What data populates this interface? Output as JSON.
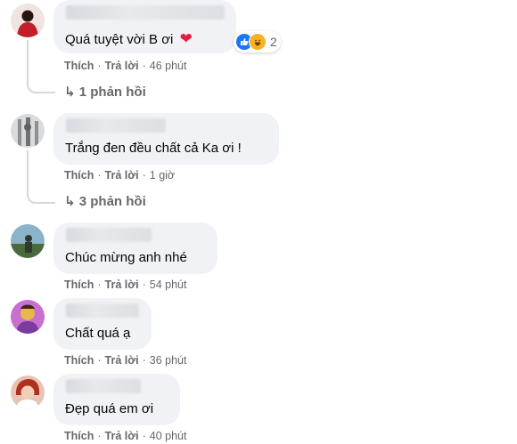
{
  "comments": [
    {
      "text": "Quá tuyệt vời B ơi",
      "emoji": "❤",
      "reaction_count": "2",
      "like": "Thích",
      "reply": "Trả lời",
      "time": "46 phút",
      "replies": "↳ 1 phản hồi",
      "colors": {
        "avatar_bg": "#c41e2a",
        "avatar_fg": "#2a1512"
      }
    },
    {
      "text": "Trắng đen đều chất cả Ka ơi !",
      "like": "Thích",
      "reply": "Trả lời",
      "time": "1 giờ",
      "replies": "↳ 3 phản hồi",
      "colors": {
        "avatar_bg": "#d9dbdc",
        "avatar_fg": "#5f6163"
      }
    },
    {
      "text": "Chúc mừng anh nhé",
      "like": "Thích",
      "reply": "Trả lời",
      "time": "54 phút",
      "colors": {
        "avatar_bg": "#8bb3c9",
        "avatar_fg": "#2f3a2d"
      }
    },
    {
      "text": "Chất quá ạ",
      "like": "Thích",
      "reply": "Trả lời",
      "time": "36 phút",
      "colors": {
        "avatar_bg": "#c86fd0",
        "avatar_fg": "#e8b64a"
      }
    },
    {
      "text": "Đẹp quá em ơi",
      "like": "Thích",
      "reply": "Trả lời",
      "time": "40 phút",
      "colors": {
        "avatar_bg": "#e8c4b6",
        "avatar_fg": "#b0301f"
      }
    }
  ],
  "icons": {
    "like_reaction": "like-icon",
    "haha_reaction": "haha-icon",
    "heart": "heart-icon",
    "reply_arrow": "reply-arrow-icon"
  },
  "colors": {
    "bubble": "#f0f2f5",
    "meta_text": "#65676b",
    "like_blue": "#1877f2",
    "heart_red": "#e41e3f"
  }
}
